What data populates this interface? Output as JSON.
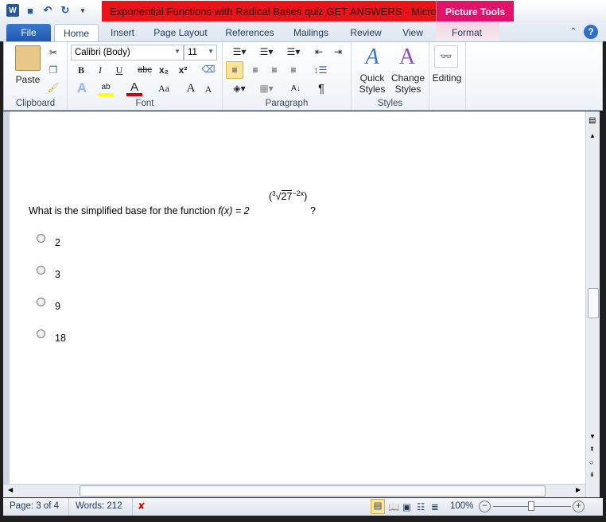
{
  "window": {
    "title": "Exponential Functions with Radical Bases quiz GET ANSWERS  -  Microsoft ...",
    "context_tab": "Picture Tools"
  },
  "tabs": [
    "File",
    "Home",
    "Insert",
    "Page Layout",
    "References",
    "Mailings",
    "Review",
    "View",
    "Format"
  ],
  "ribbon": {
    "clipboard": {
      "label": "Clipboard",
      "paste": "Paste"
    },
    "font": {
      "label": "Font",
      "font_name": "Calibri (Body)",
      "font_size": "11",
      "bold": "B",
      "italic": "I",
      "underline": "U",
      "strike": "abc",
      "subscript": "x₂",
      "superscript": "x²",
      "grow": "A",
      "shrink": "A",
      "case": "Aa"
    },
    "paragraph": {
      "label": "Paragraph",
      "pilcrow": "¶"
    },
    "styles": {
      "label": "Styles",
      "quick": "Quick",
      "quick2": "Styles",
      "change": "Change",
      "change2": "Styles"
    },
    "editing": {
      "label": "Editing"
    }
  },
  "document": {
    "question_prefix": "What is the simplified base for the function ",
    "fx": "f(x) = 2",
    "exponent_root_index": "3",
    "exponent_radicand": "27",
    "exponent_power": "−2x",
    "question_suffix": "?",
    "options": [
      "2",
      "3",
      "9",
      "18"
    ]
  },
  "status": {
    "page": "Page: 3 of 4",
    "words": "Words: 212",
    "zoom": "100%",
    "zoom_level": 100,
    "colors": {
      "accent": "#2b5797",
      "title_red": "#e8141a"
    }
  }
}
